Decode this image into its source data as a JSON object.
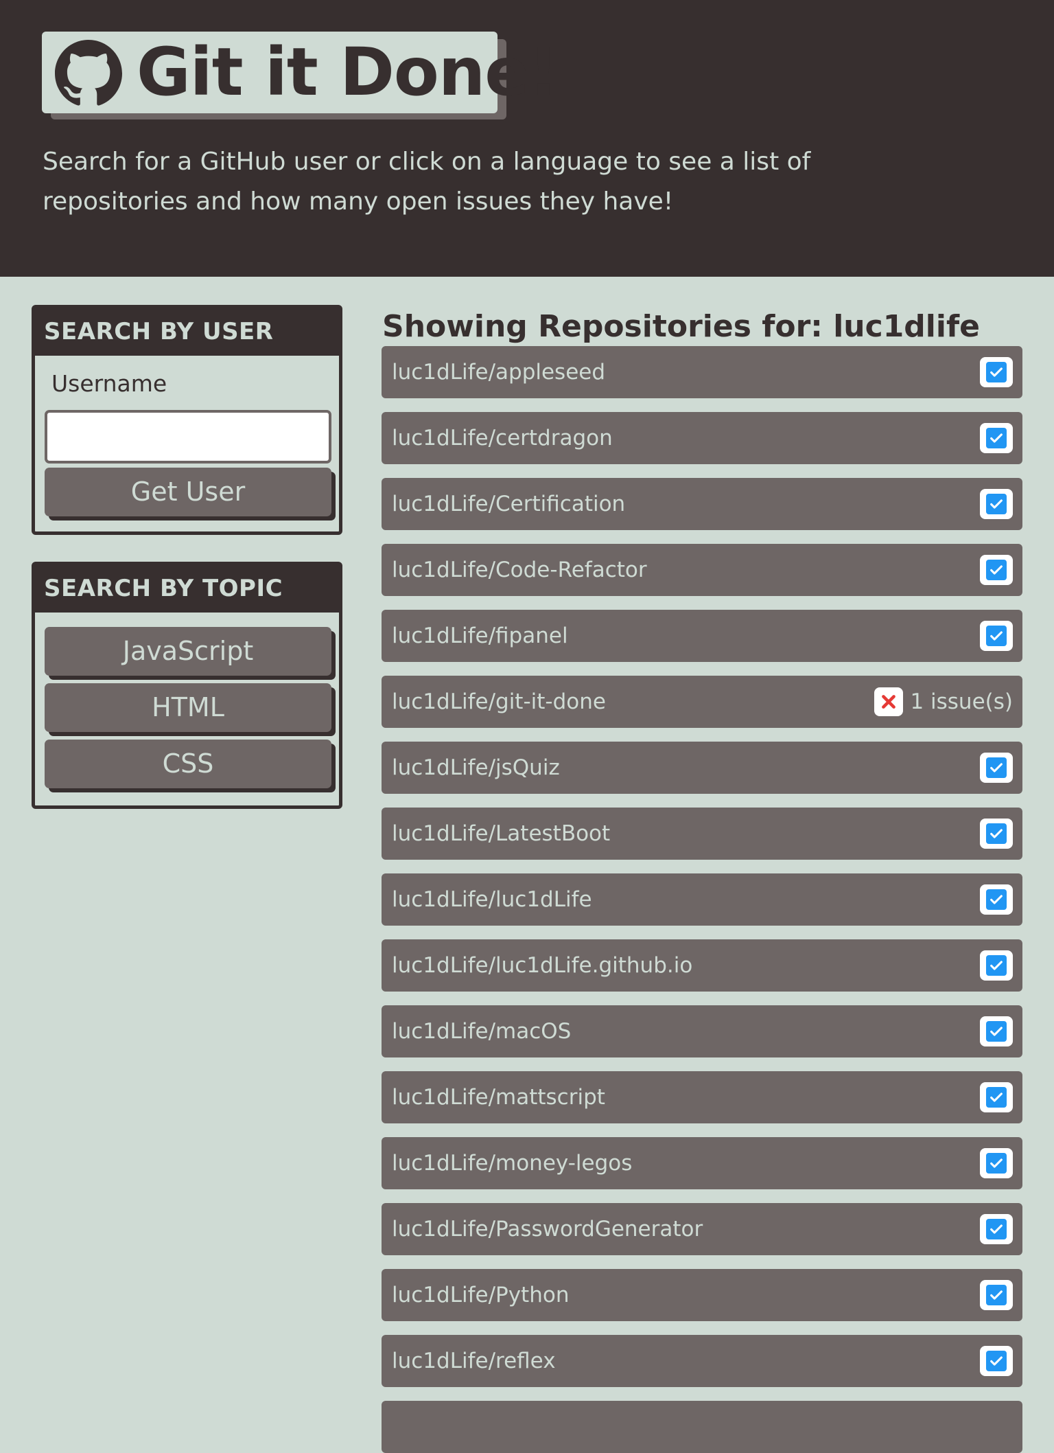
{
  "header": {
    "title": "Git it Done!",
    "logo_icon": "github-octocat-icon",
    "subtitle": "Search for a GitHub user or click on a language to see a list of repositories and how many open issues they have!"
  },
  "user_search": {
    "heading": "SEARCH BY USER",
    "username_label": "Username",
    "username_value": "",
    "button_label": "Get User"
  },
  "topic_search": {
    "heading": "SEARCH BY TOPIC",
    "languages": [
      "JavaScript",
      "HTML",
      "CSS"
    ]
  },
  "results": {
    "title": "Showing Repositories for: luc1dlife",
    "repos": [
      {
        "name": "luc1dLife/appleseed",
        "status": "check-icon",
        "issues": ""
      },
      {
        "name": "luc1dLife/certdragon",
        "status": "check-icon",
        "issues": ""
      },
      {
        "name": "luc1dLife/Certification",
        "status": "check-icon",
        "issues": ""
      },
      {
        "name": "luc1dLife/Code-Refactor",
        "status": "check-icon",
        "issues": ""
      },
      {
        "name": "luc1dLife/fipanel",
        "status": "check-icon",
        "issues": ""
      },
      {
        "name": "luc1dLife/git-it-done",
        "status": "x-icon",
        "issues": "1 issue(s)"
      },
      {
        "name": "luc1dLife/jsQuiz",
        "status": "check-icon",
        "issues": ""
      },
      {
        "name": "luc1dLife/LatestBoot",
        "status": "check-icon",
        "issues": ""
      },
      {
        "name": "luc1dLife/luc1dLife",
        "status": "check-icon",
        "issues": ""
      },
      {
        "name": "luc1dLife/luc1dLife.github.io",
        "status": "check-icon",
        "issues": ""
      },
      {
        "name": "luc1dLife/macOS",
        "status": "check-icon",
        "issues": ""
      },
      {
        "name": "luc1dLife/mattscript",
        "status": "check-icon",
        "issues": ""
      },
      {
        "name": "luc1dLife/money-legos",
        "status": "check-icon",
        "issues": ""
      },
      {
        "name": "luc1dLife/PasswordGenerator",
        "status": "check-icon",
        "issues": ""
      },
      {
        "name": "luc1dLife/Python",
        "status": "check-icon",
        "issues": ""
      },
      {
        "name": "luc1dLife/reflex",
        "status": "check-icon",
        "issues": ""
      },
      {
        "name": "",
        "status": "",
        "issues": ""
      }
    ]
  },
  "colors": {
    "dark": "#372f2f",
    "panel": "#6e6665",
    "background": "#cfdbd4",
    "check_blue": "#2196f3",
    "x_red": "#e53935"
  }
}
